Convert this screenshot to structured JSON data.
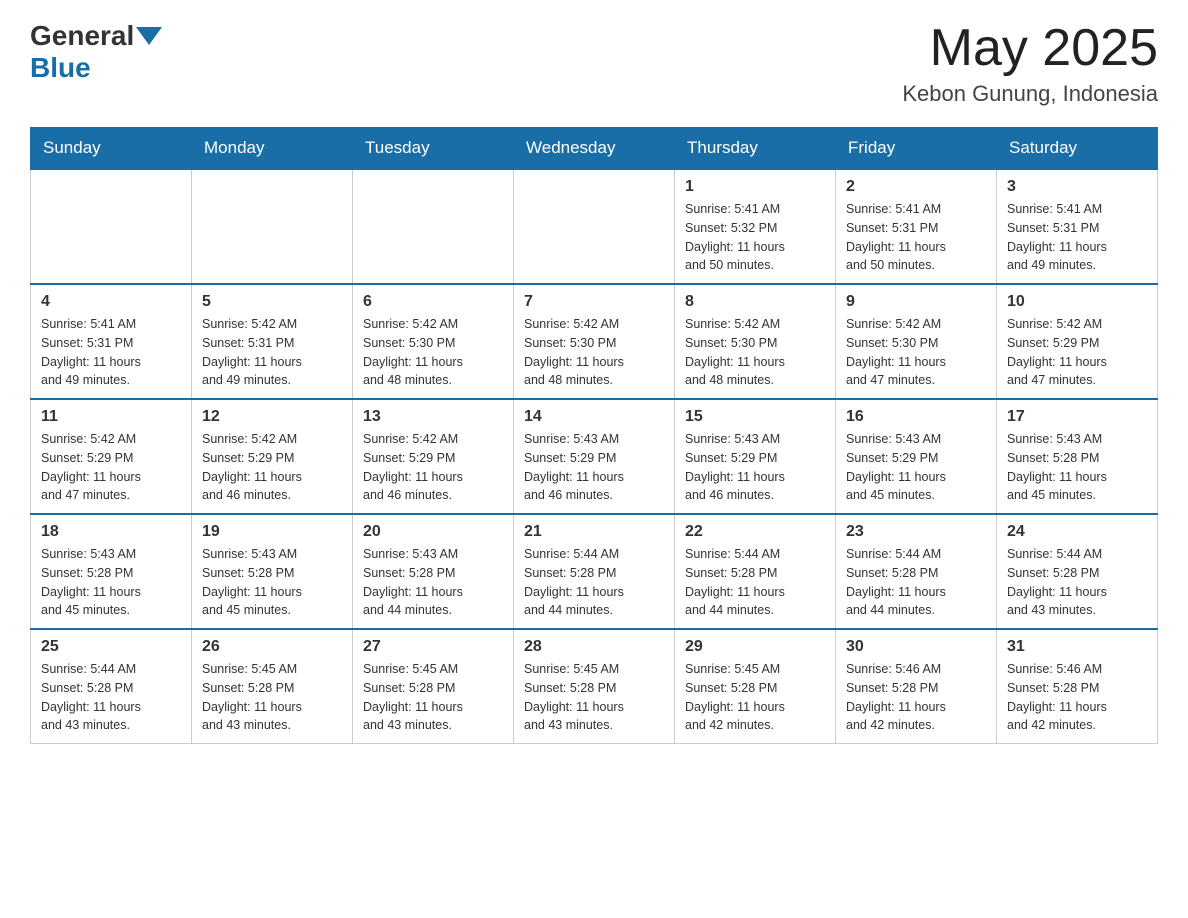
{
  "header": {
    "logo_general": "General",
    "logo_blue": "Blue",
    "month_year": "May 2025",
    "location": "Kebon Gunung, Indonesia"
  },
  "calendar": {
    "days_of_week": [
      "Sunday",
      "Monday",
      "Tuesday",
      "Wednesday",
      "Thursday",
      "Friday",
      "Saturday"
    ],
    "weeks": [
      [
        {
          "day": "",
          "info": ""
        },
        {
          "day": "",
          "info": ""
        },
        {
          "day": "",
          "info": ""
        },
        {
          "day": "",
          "info": ""
        },
        {
          "day": "1",
          "info": "Sunrise: 5:41 AM\nSunset: 5:32 PM\nDaylight: 11 hours\nand 50 minutes."
        },
        {
          "day": "2",
          "info": "Sunrise: 5:41 AM\nSunset: 5:31 PM\nDaylight: 11 hours\nand 50 minutes."
        },
        {
          "day": "3",
          "info": "Sunrise: 5:41 AM\nSunset: 5:31 PM\nDaylight: 11 hours\nand 49 minutes."
        }
      ],
      [
        {
          "day": "4",
          "info": "Sunrise: 5:41 AM\nSunset: 5:31 PM\nDaylight: 11 hours\nand 49 minutes."
        },
        {
          "day": "5",
          "info": "Sunrise: 5:42 AM\nSunset: 5:31 PM\nDaylight: 11 hours\nand 49 minutes."
        },
        {
          "day": "6",
          "info": "Sunrise: 5:42 AM\nSunset: 5:30 PM\nDaylight: 11 hours\nand 48 minutes."
        },
        {
          "day": "7",
          "info": "Sunrise: 5:42 AM\nSunset: 5:30 PM\nDaylight: 11 hours\nand 48 minutes."
        },
        {
          "day": "8",
          "info": "Sunrise: 5:42 AM\nSunset: 5:30 PM\nDaylight: 11 hours\nand 48 minutes."
        },
        {
          "day": "9",
          "info": "Sunrise: 5:42 AM\nSunset: 5:30 PM\nDaylight: 11 hours\nand 47 minutes."
        },
        {
          "day": "10",
          "info": "Sunrise: 5:42 AM\nSunset: 5:29 PM\nDaylight: 11 hours\nand 47 minutes."
        }
      ],
      [
        {
          "day": "11",
          "info": "Sunrise: 5:42 AM\nSunset: 5:29 PM\nDaylight: 11 hours\nand 47 minutes."
        },
        {
          "day": "12",
          "info": "Sunrise: 5:42 AM\nSunset: 5:29 PM\nDaylight: 11 hours\nand 46 minutes."
        },
        {
          "day": "13",
          "info": "Sunrise: 5:42 AM\nSunset: 5:29 PM\nDaylight: 11 hours\nand 46 minutes."
        },
        {
          "day": "14",
          "info": "Sunrise: 5:43 AM\nSunset: 5:29 PM\nDaylight: 11 hours\nand 46 minutes."
        },
        {
          "day": "15",
          "info": "Sunrise: 5:43 AM\nSunset: 5:29 PM\nDaylight: 11 hours\nand 46 minutes."
        },
        {
          "day": "16",
          "info": "Sunrise: 5:43 AM\nSunset: 5:29 PM\nDaylight: 11 hours\nand 45 minutes."
        },
        {
          "day": "17",
          "info": "Sunrise: 5:43 AM\nSunset: 5:28 PM\nDaylight: 11 hours\nand 45 minutes."
        }
      ],
      [
        {
          "day": "18",
          "info": "Sunrise: 5:43 AM\nSunset: 5:28 PM\nDaylight: 11 hours\nand 45 minutes."
        },
        {
          "day": "19",
          "info": "Sunrise: 5:43 AM\nSunset: 5:28 PM\nDaylight: 11 hours\nand 45 minutes."
        },
        {
          "day": "20",
          "info": "Sunrise: 5:43 AM\nSunset: 5:28 PM\nDaylight: 11 hours\nand 44 minutes."
        },
        {
          "day": "21",
          "info": "Sunrise: 5:44 AM\nSunset: 5:28 PM\nDaylight: 11 hours\nand 44 minutes."
        },
        {
          "day": "22",
          "info": "Sunrise: 5:44 AM\nSunset: 5:28 PM\nDaylight: 11 hours\nand 44 minutes."
        },
        {
          "day": "23",
          "info": "Sunrise: 5:44 AM\nSunset: 5:28 PM\nDaylight: 11 hours\nand 44 minutes."
        },
        {
          "day": "24",
          "info": "Sunrise: 5:44 AM\nSunset: 5:28 PM\nDaylight: 11 hours\nand 43 minutes."
        }
      ],
      [
        {
          "day": "25",
          "info": "Sunrise: 5:44 AM\nSunset: 5:28 PM\nDaylight: 11 hours\nand 43 minutes."
        },
        {
          "day": "26",
          "info": "Sunrise: 5:45 AM\nSunset: 5:28 PM\nDaylight: 11 hours\nand 43 minutes."
        },
        {
          "day": "27",
          "info": "Sunrise: 5:45 AM\nSunset: 5:28 PM\nDaylight: 11 hours\nand 43 minutes."
        },
        {
          "day": "28",
          "info": "Sunrise: 5:45 AM\nSunset: 5:28 PM\nDaylight: 11 hours\nand 43 minutes."
        },
        {
          "day": "29",
          "info": "Sunrise: 5:45 AM\nSunset: 5:28 PM\nDaylight: 11 hours\nand 42 minutes."
        },
        {
          "day": "30",
          "info": "Sunrise: 5:46 AM\nSunset: 5:28 PM\nDaylight: 11 hours\nand 42 minutes."
        },
        {
          "day": "31",
          "info": "Sunrise: 5:46 AM\nSunset: 5:28 PM\nDaylight: 11 hours\nand 42 minutes."
        }
      ]
    ]
  }
}
